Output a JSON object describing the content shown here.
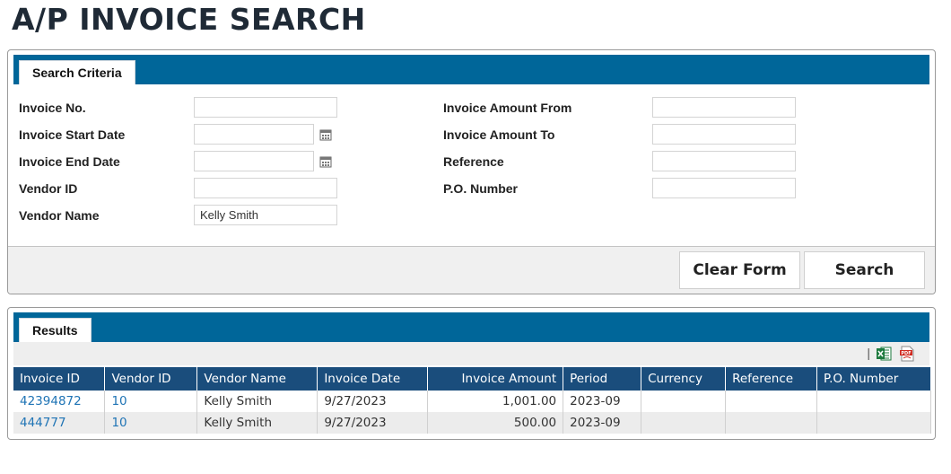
{
  "page": {
    "title": "A/P INVOICE SEARCH"
  },
  "criteria": {
    "tab_label": "Search Criteria",
    "left_fields": [
      {
        "label": "Invoice No.",
        "value": ""
      },
      {
        "label": "Invoice Start Date",
        "value": ""
      },
      {
        "label": "Invoice End Date",
        "value": ""
      },
      {
        "label": "Vendor ID",
        "value": ""
      },
      {
        "label": "Vendor Name",
        "value": "Kelly Smith"
      }
    ],
    "right_fields": [
      {
        "label": "Invoice Amount From",
        "value": ""
      },
      {
        "label": "Invoice Amount To",
        "value": ""
      },
      {
        "label": "Reference",
        "value": ""
      },
      {
        "label": "P.O. Number",
        "value": ""
      }
    ],
    "calendar_icon": "calendar-icon",
    "buttons": {
      "clear": "Clear Form",
      "search": "Search"
    }
  },
  "results": {
    "tab_label": "Results",
    "toolbar": {
      "separator": "|",
      "excel_icon": "excel-export-icon",
      "pdf_icon": "pdf-export-icon"
    },
    "columns": [
      "Invoice ID",
      "Vendor ID",
      "Vendor Name",
      "Invoice Date",
      "Invoice Amount",
      "Period",
      "Currency",
      "Reference",
      "P.O. Number"
    ],
    "rows": [
      {
        "invoice_id": "42394872",
        "vendor_id": "10",
        "vendor_name": "Kelly Smith",
        "invoice_date": "9/27/2023",
        "amount": "1,001.00",
        "period": "2023-09",
        "currency": "",
        "reference": "",
        "po_number": ""
      },
      {
        "invoice_id": "444777",
        "vendor_id": "10",
        "vendor_name": "Kelly Smith",
        "invoice_date": "9/27/2023",
        "amount": "500.00",
        "period": "2023-09",
        "currency": "",
        "reference": "",
        "po_number": ""
      }
    ]
  },
  "colors": {
    "header_blue": "#006699",
    "grid_header": "#1a4d7c",
    "link": "#1f74b5"
  }
}
